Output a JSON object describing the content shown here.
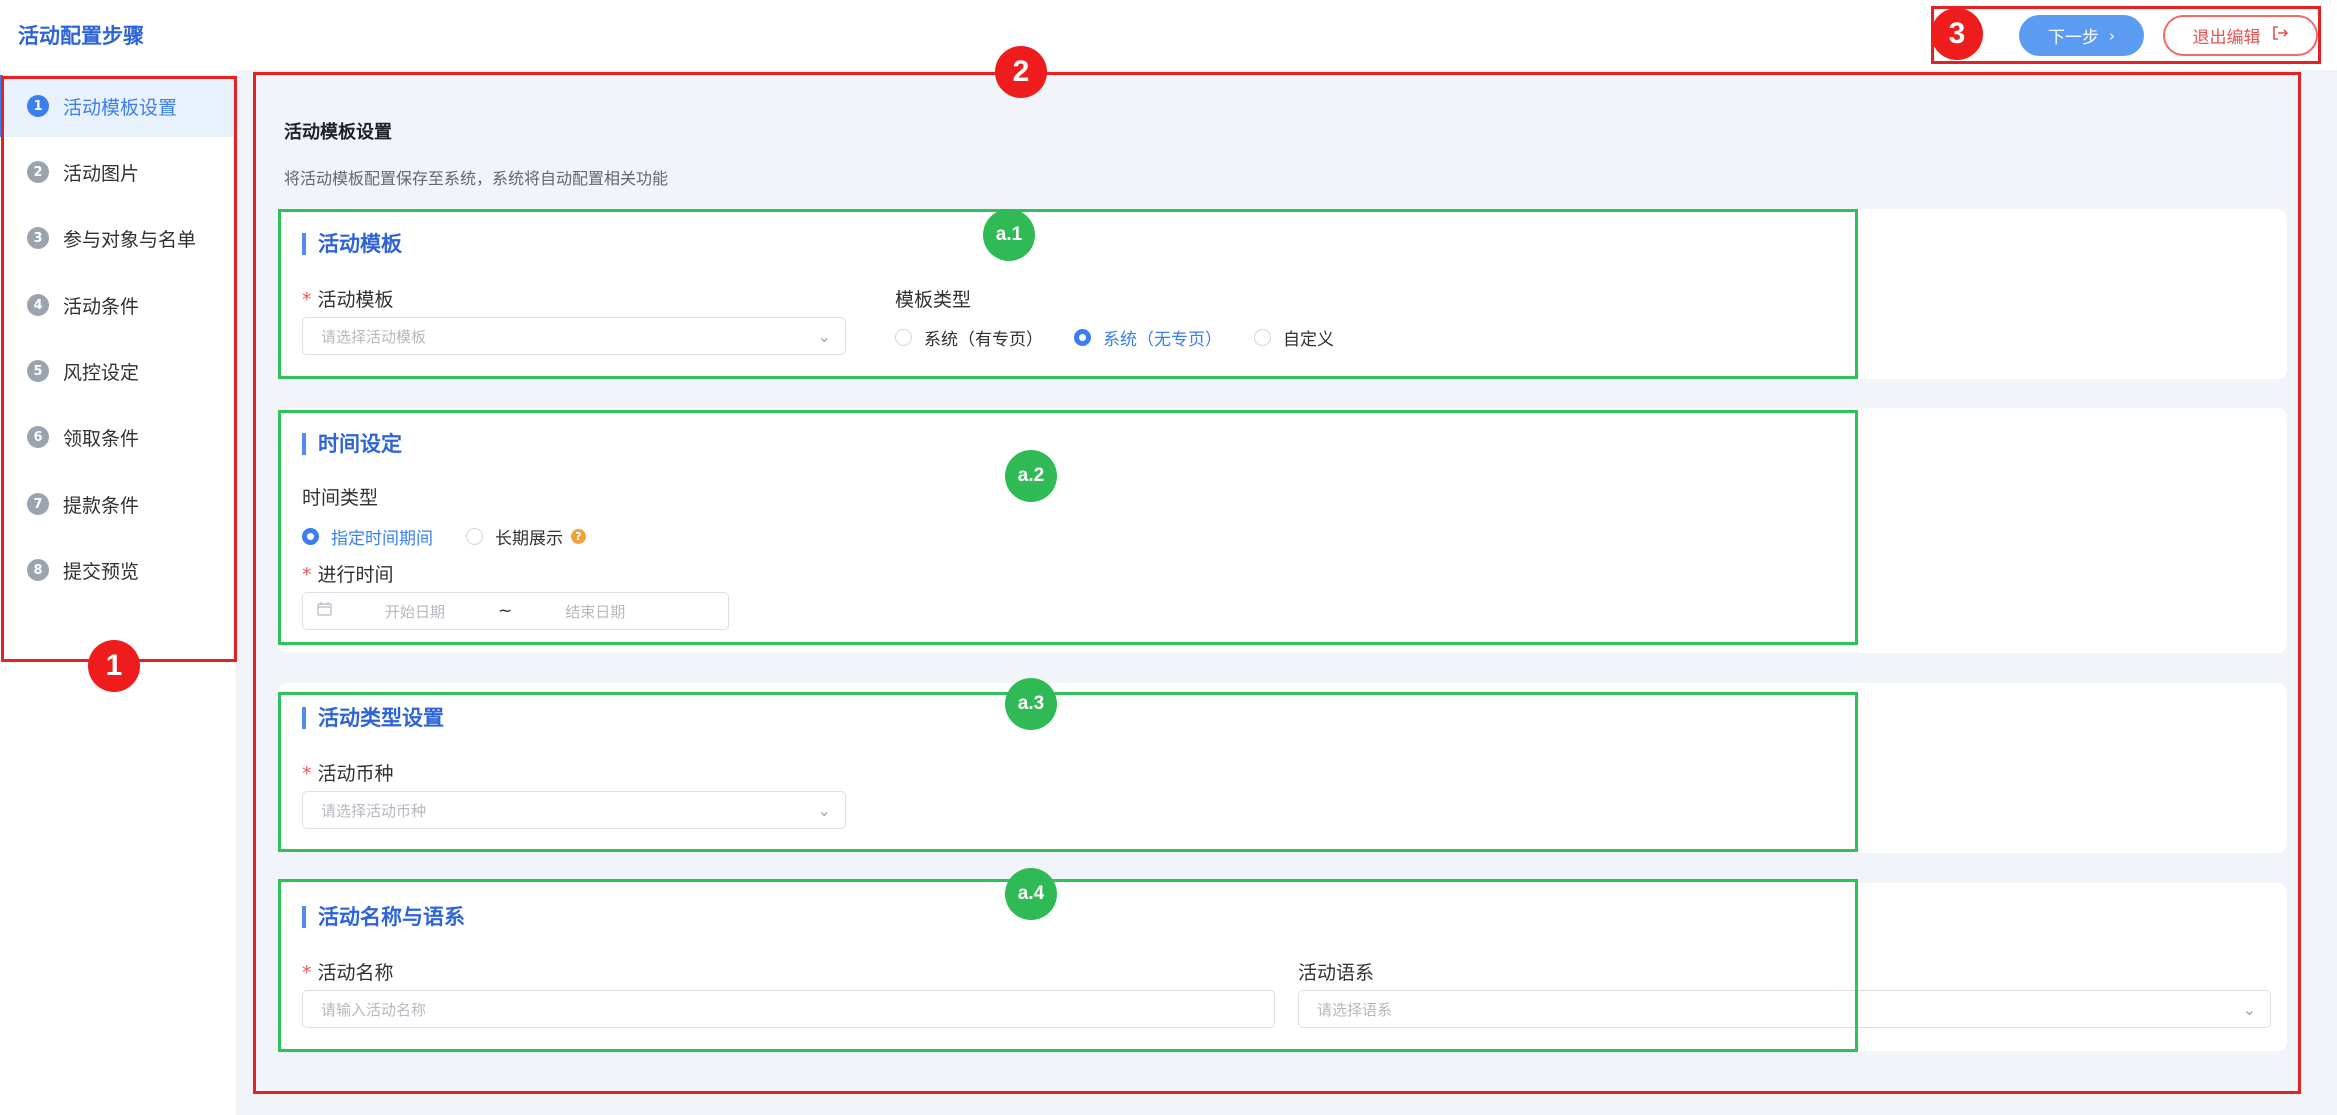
{
  "header": {
    "title": "活动配置步骤",
    "next_label": "下一步",
    "exit_label": "退出编辑"
  },
  "sidebar": {
    "steps": [
      {
        "num": "1",
        "label": "活动模板设置"
      },
      {
        "num": "2",
        "label": "活动图片"
      },
      {
        "num": "3",
        "label": "参与对象与名单"
      },
      {
        "num": "4",
        "label": "活动条件"
      },
      {
        "num": "5",
        "label": "风控设定"
      },
      {
        "num": "6",
        "label": "领取条件"
      },
      {
        "num": "7",
        "label": "提款条件"
      },
      {
        "num": "8",
        "label": "提交预览"
      }
    ]
  },
  "form": {
    "title": "活动模板设置",
    "subtitle": "将活动模板配置保存至系统，系统将自动配置相关功能"
  },
  "section_template": {
    "title": "活动模板",
    "template_label": "活动模板",
    "template_placeholder": "请选择活动模板",
    "type_label": "模板类型",
    "options": [
      "系统（有专页）",
      "系统（无专页）",
      "自定义"
    ],
    "selected": "系统（无专页）"
  },
  "section_time": {
    "title": "时间设定",
    "type_label": "时间类型",
    "options": [
      "指定时间期间",
      "长期展示"
    ],
    "selected": "指定时间期间",
    "range_label": "进行时间",
    "start_placeholder": "开始日期",
    "separator": "~",
    "end_placeholder": "结束日期"
  },
  "section_type": {
    "title": "活动类型设置",
    "currency_label": "活动币种",
    "currency_placeholder": "请选择活动币种"
  },
  "section_name": {
    "title": "活动名称与语系",
    "name_label": "活动名称",
    "name_placeholder": "请输入活动名称",
    "lang_label": "活动语系",
    "lang_placeholder": "请选择语系"
  },
  "annotations": {
    "red": [
      "1",
      "2",
      "3"
    ],
    "green": [
      "a.1",
      "a.2",
      "a.3",
      "a.4"
    ]
  },
  "colors": {
    "accent": "#3a7ef0",
    "annotation_red": "#e52121",
    "annotation_green": "#2fc25b"
  }
}
